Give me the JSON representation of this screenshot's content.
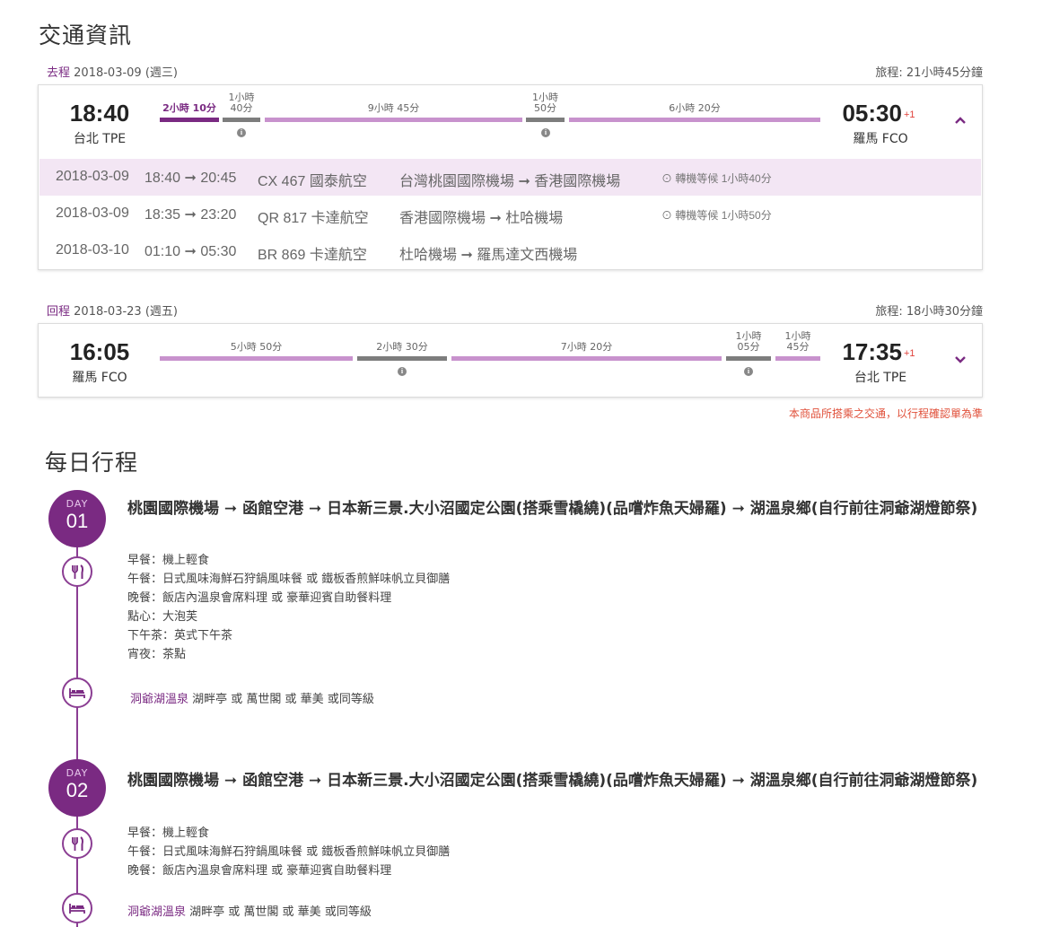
{
  "transport": {
    "title": "交通資訊",
    "outbound": {
      "direction": "去程",
      "date": "2018-03-09 (週三)",
      "total_label": "旅程: 21小時45分鐘",
      "dep_time": "18:40",
      "dep_city": "台北 TPE",
      "arr_time": "05:30",
      "arr_plus": "+1",
      "arr_city": "羅馬 FCO",
      "segments": [
        {
          "label": "2小時 10分",
          "kind": "fly-active"
        },
        {
          "label": "1小時\n40分",
          "kind": "wait"
        },
        {
          "label": "9小時 45分",
          "kind": "fly"
        },
        {
          "label": "1小時\n50分",
          "kind": "wait"
        },
        {
          "label": "6小時 20分",
          "kind": "fly"
        }
      ],
      "flights": [
        {
          "date": "2018-03-09",
          "time": "18:40 ➞ 20:45",
          "flight": "CX 467 國泰航空",
          "route": "台灣桃園國際機場 ➞ 香港國際機場",
          "wait": "轉機等候 1小時40分"
        },
        {
          "date": "2018-03-09",
          "time": "18:35 ➞ 23:20",
          "flight": "QR 817 卡達航空",
          "route": "香港國際機場 ➞ 杜哈機場",
          "wait": "轉機等候 1小時50分"
        },
        {
          "date": "2018-03-10",
          "time": "01:10 ➞ 05:30",
          "flight": "BR 869 卡達航空",
          "route": "杜哈機場 ➞ 羅馬達文西機場",
          "wait": ""
        }
      ]
    },
    "inbound": {
      "direction": "回程",
      "date": "2018-03-23 (週五)",
      "total_label": "旅程: 18小時30分鐘",
      "dep_time": "16:05",
      "dep_city": "羅馬 FCO",
      "arr_time": "17:35",
      "arr_plus": "+1",
      "arr_city": "台北 TPE",
      "segments": [
        {
          "label": "5小時 50分",
          "kind": "fly"
        },
        {
          "label": "2小時 30分",
          "kind": "wait"
        },
        {
          "label": "7小時 20分",
          "kind": "fly"
        },
        {
          "label": "1小時\n05分",
          "kind": "wait"
        },
        {
          "label": "1小時\n45分",
          "kind": "fly"
        }
      ]
    },
    "note": "本商品所搭乘之交通，以行程確認單為準"
  },
  "itinerary": {
    "title": "每日行程",
    "days": [
      {
        "day_word": "DAY",
        "day_num": "01",
        "route": "桃園國際機場 ➞ 函館空港 ➞ 日本新三景.大小沼國定公園(搭乘雪橇繞)(品嚐炸魚天婦羅) ➞ 湖溫泉鄉(自行前往洞爺湖燈節祭)",
        "meals": [
          "早餐：機上輕食",
          "午餐：日式風味海鮮石狩鍋風味餐 或 鐵板香煎鮮味帆立貝御膳",
          "晚餐：飯店內溫泉會席料理 或 豪華迎賓自助餐料理",
          "點心：大泡芙",
          "下午茶：英式下午茶",
          "宵夜：茶點"
        ],
        "hotel_name": "洞爺湖溫泉",
        "hotel_rest": "湖畔亭 或 萬世閣 或 華美 或同等級"
      },
      {
        "day_word": "DAY",
        "day_num": "02",
        "route": "桃園國際機場 ➞ 函館空港 ➞ 日本新三景.大小沼國定公園(搭乘雪橇繞)(品嚐炸魚天婦羅) ➞ 湖溫泉鄉(自行前往洞爺湖燈節祭)",
        "meals": [
          "早餐：機上輕食",
          "午餐：日式風味海鮮石狩鍋風味餐 或 鐵板香煎鮮味帆立貝御膳",
          "晚餐：飯店內溫泉會席料理 或 豪華迎賓自助餐料理"
        ],
        "hotel_name": "洞爺湖溫泉",
        "hotel_rest": "湖畔亭 或 萬世閣 或 華美 或同等級"
      }
    ]
  },
  "icons": {
    "accent_color": "#7a2a82",
    "fly_bar_color": "#c892cd",
    "wait_bar_color": "#7d7d7d"
  }
}
